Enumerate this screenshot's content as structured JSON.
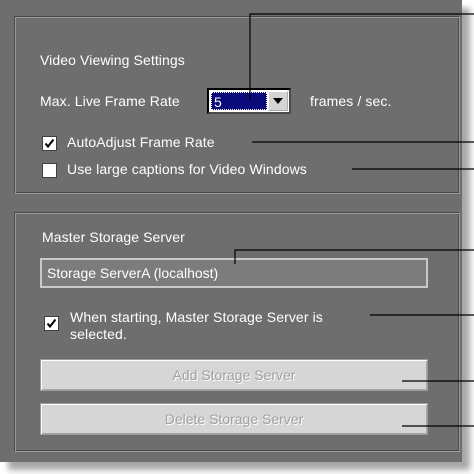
{
  "video_settings": {
    "title": "Video Viewing Settings",
    "frame_rate_label": "Max. Live Frame Rate",
    "frame_rate_value": "5",
    "frame_rate_unit": "frames / sec.",
    "auto_adjust_label": "AutoAdjust Frame Rate",
    "auto_adjust_checked": true,
    "large_captions_label": "Use large captions for Video Windows",
    "large_captions_checked": false
  },
  "storage": {
    "title": "Master Storage Server",
    "server_value": "Storage ServerA (localhost)",
    "selected_label_line1": "When starting, Master Storage Server is",
    "selected_label_line2": "selected.",
    "selected_checked": true,
    "add_button": "Add Storage Server",
    "delete_button": "Delete Storage Server"
  },
  "colors": {
    "panel": "#6e6e6e",
    "selection": "#0a0a7a",
    "button_face": "#d6d6d6",
    "disabled_text": "#a0a0a0"
  }
}
